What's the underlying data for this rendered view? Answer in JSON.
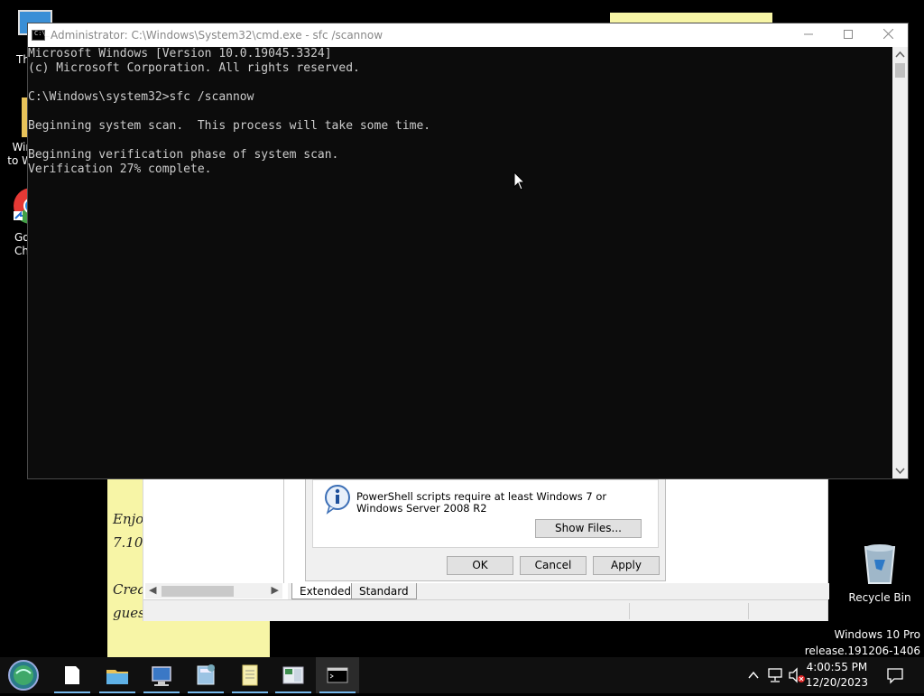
{
  "desktop": {
    "icons": [
      {
        "label": "Th"
      },
      {
        "label": "Win to W"
      },
      {
        "label": "Go Ch"
      },
      {
        "label": "Recycle Bin"
      }
    ],
    "watermark_line1": "Windows 10 Pro",
    "watermark_line2": "release.191206-1406"
  },
  "sticky_note": {
    "lines": [
      "Enjo",
      "7.10",
      "Crea",
      "gues"
    ]
  },
  "props_dialog": {
    "info_text": "PowerShell scripts require at least Windows 7 or Windows Server 2008 R2",
    "show_files_label": "Show Files...",
    "ok_label": "OK",
    "cancel_label": "Cancel",
    "apply_label": "Apply",
    "tab_extended": "Extended",
    "tab_standard": "Standard"
  },
  "cmd": {
    "title": "Administrator: C:\\Windows\\System32\\cmd.exe - sfc  /scannow",
    "icon_glyph": "C:\\_",
    "lines": [
      "Microsoft Windows [Version 10.0.19045.3324]",
      "(c) Microsoft Corporation. All rights reserved.",
      "",
      "C:\\Windows\\system32>sfc /scannow",
      "",
      "Beginning system scan.  This process will take some time.",
      "",
      "Beginning verification phase of system scan.",
      "Verification 27% complete."
    ]
  },
  "taskbar": {
    "time": "4:00:55 PM",
    "date": "12/20/2023",
    "items": [
      "start-orb-icon",
      "file-icon",
      "file-explorer-icon",
      "remote-desktop-icon",
      "calculator-icon",
      "notepad-icon",
      "control-panel-icon",
      "cmd-icon"
    ]
  },
  "colors": {
    "console_bg": "#0c0c0c",
    "console_text": "#cccccc",
    "sticky": "#f7f5a6",
    "taskbar_accent": "#76b9ed"
  }
}
